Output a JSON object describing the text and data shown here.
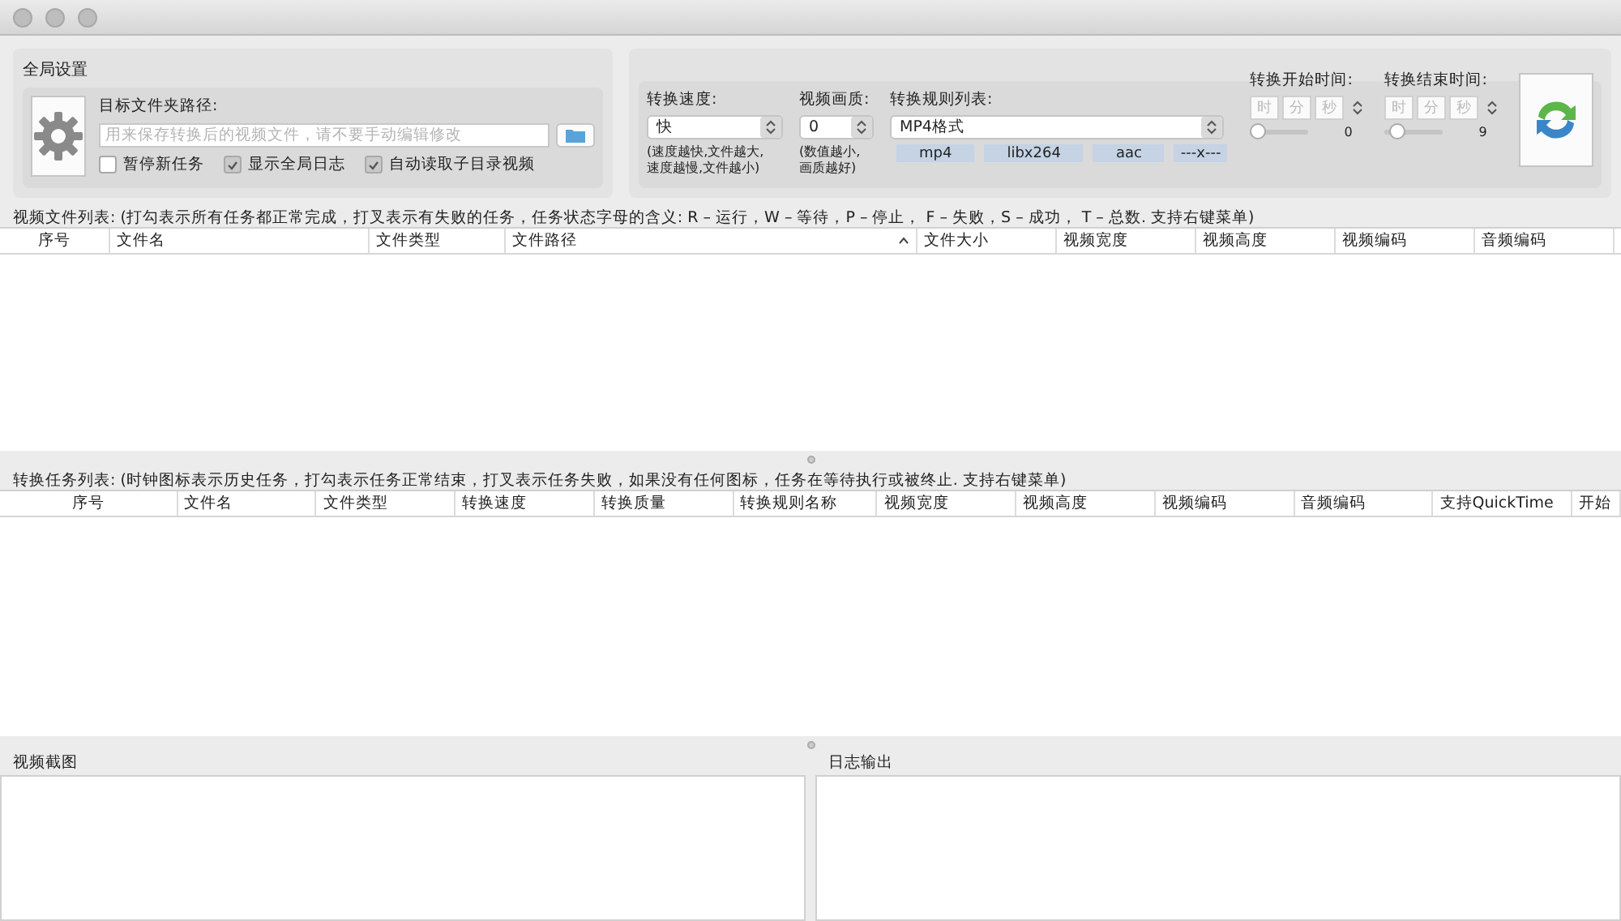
{
  "global_settings": {
    "title": "全局设置",
    "target_label": "目标文件夹路径:",
    "target_placeholder": "用来保存转换后的视频文件，请不要手动编辑修改",
    "checkboxes": [
      {
        "label": "暂停新任务",
        "checked": false
      },
      {
        "label": "显示全局日志",
        "checked": true
      },
      {
        "label": "自动读取子目录视频",
        "checked": true
      }
    ]
  },
  "conversion": {
    "speed": {
      "label": "转换速度:",
      "value": "快",
      "hint": "(速度越快,文件越大,\n速度越慢,文件越小)"
    },
    "quality": {
      "label": "视频画质:",
      "value": "0",
      "hint": "(数值越小,\n画质越好)"
    },
    "rules": {
      "label": "转换规则列表:",
      "value": "MP4格式",
      "tags": [
        "mp4",
        "libx264",
        "aac",
        "---x---"
      ]
    },
    "times": [
      {
        "label": "转换开始时间:",
        "fields": [
          "时",
          "分",
          "秒"
        ],
        "level": 0,
        "reading": "0"
      },
      {
        "label": "转换结束时间:",
        "fields": [
          "时",
          "分",
          "秒"
        ],
        "level": 0.1,
        "reading": "9"
      }
    ]
  },
  "file_list": {
    "caption": "视频文件列表: (打勾表示所有任务都正常完成，打叉表示有失败的任务，任务状态字母的含义: R – 运行，W – 等待，P – 停止， F – 失败，S – 成功， T – 总数. 支持右键菜单)",
    "columns": [
      {
        "label": "序号",
        "sorted": false
      },
      {
        "label": "文件名",
        "sorted": false
      },
      {
        "label": "文件类型",
        "sorted": false
      },
      {
        "label": "文件路径",
        "sorted": true
      },
      {
        "label": "文件大小",
        "sorted": false
      },
      {
        "label": "视频宽度",
        "sorted": false
      },
      {
        "label": "视频高度",
        "sorted": false
      },
      {
        "label": "视频编码",
        "sorted": false
      },
      {
        "label": "音频编码",
        "sorted": false
      }
    ]
  },
  "task_list": {
    "caption": "转换任务列表: (时钟图标表示历史任务，打勾表示任务正常结束，打叉表示任务失败，如果没有任何图标，任务在等待执行或被终止. 支持右键菜单)",
    "columns": [
      "序号",
      "文件名",
      "文件类型",
      "转换速度",
      "转换质量",
      "转换规则名称",
      "视频宽度",
      "视频高度",
      "视频编码",
      "音频编码",
      "支持QuickTime",
      "开始"
    ]
  },
  "bottom_panels": [
    "视频截图",
    "日志输出"
  ]
}
